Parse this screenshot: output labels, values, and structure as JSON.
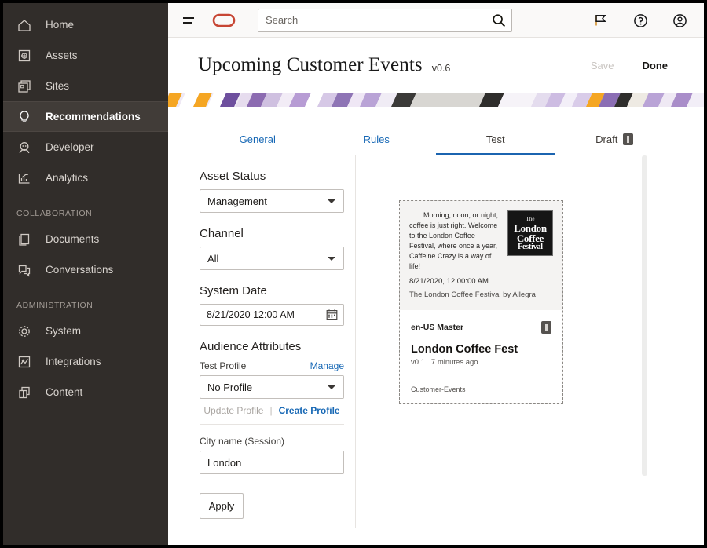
{
  "sidebar": {
    "items": [
      {
        "label": "Home",
        "icon": "home-icon",
        "active": false
      },
      {
        "label": "Assets",
        "icon": "assets-icon",
        "active": false
      },
      {
        "label": "Sites",
        "icon": "sites-icon",
        "active": false
      },
      {
        "label": "Recommendations",
        "icon": "lightbulb-icon",
        "active": true
      },
      {
        "label": "Developer",
        "icon": "developer-icon",
        "active": false
      },
      {
        "label": "Analytics",
        "icon": "analytics-icon",
        "active": false
      }
    ],
    "section_collaboration": "COLLABORATION",
    "collaboration_items": [
      {
        "label": "Documents",
        "icon": "documents-icon"
      },
      {
        "label": "Conversations",
        "icon": "conversations-icon"
      }
    ],
    "section_administration": "ADMINISTRATION",
    "administration_items": [
      {
        "label": "System",
        "icon": "gear-icon"
      },
      {
        "label": "Integrations",
        "icon": "integrations-icon"
      },
      {
        "label": "Content",
        "icon": "content-icon"
      }
    ],
    "bg_color": "#312d2a",
    "active_bg_color": "#413c38"
  },
  "appbar": {
    "menu_icon": "hamburger-icon",
    "logo_icon": "oracle-logo-icon",
    "logo_color": "#c74634",
    "search": {
      "placeholder": "Search",
      "value": "",
      "icon": "search-icon"
    },
    "icons": [
      {
        "name": "flag-icon"
      },
      {
        "name": "help-circle-icon"
      },
      {
        "name": "user-avatar-icon"
      }
    ]
  },
  "header": {
    "title": "Upcoming Customer Events",
    "version": "v0.6",
    "save_label": "Save",
    "save_enabled": false,
    "done_label": "Done"
  },
  "tabs": [
    {
      "label": "General",
      "active": false,
      "style": "link"
    },
    {
      "label": "Rules",
      "active": false,
      "style": "link"
    },
    {
      "label": "Test",
      "active": true,
      "style": "plain"
    },
    {
      "label": "Draft",
      "active": false,
      "style": "plain",
      "badge": "info-badge"
    }
  ],
  "accent_color": "#1b64b0",
  "left_panel": {
    "asset_status_label": "Asset Status",
    "asset_status_value": "Management",
    "channel_label": "Channel",
    "channel_value": "All",
    "system_date_label": "System Date",
    "system_date_value": "8/21/2020 12:00 AM",
    "calendar_icon": "calendar-icon",
    "audience_attributes_label": "Audience Attributes",
    "test_profile_label": "Test Profile",
    "manage_link": "Manage",
    "test_profile_value": "No Profile",
    "update_profile_link": "Update Profile",
    "update_profile_enabled": false,
    "separator": "|",
    "create_profile_link": "Create Profile",
    "city_label": "City name (Session)",
    "city_value": "London",
    "apply_label": "Apply"
  },
  "preview": {
    "promo_text": "Morning, noon, or night, coffee is just right. Welcome to the London Coffee Festival, where once a year, Caffeine Crazy is a way of life!",
    "logo_line1": "The",
    "logo_line2": "London",
    "logo_line3": "Coffee",
    "logo_line4": "Festival",
    "date": "8/21/2020, 12:00:00 AM",
    "subtitle": "The London Coffee Festival by Allegra",
    "locale": "en-US  Master",
    "badge": "info-badge",
    "title": "London Coffee Fest",
    "version": "v0.1",
    "timestamp": "7 minutes ago",
    "tag": "Customer-Events"
  }
}
